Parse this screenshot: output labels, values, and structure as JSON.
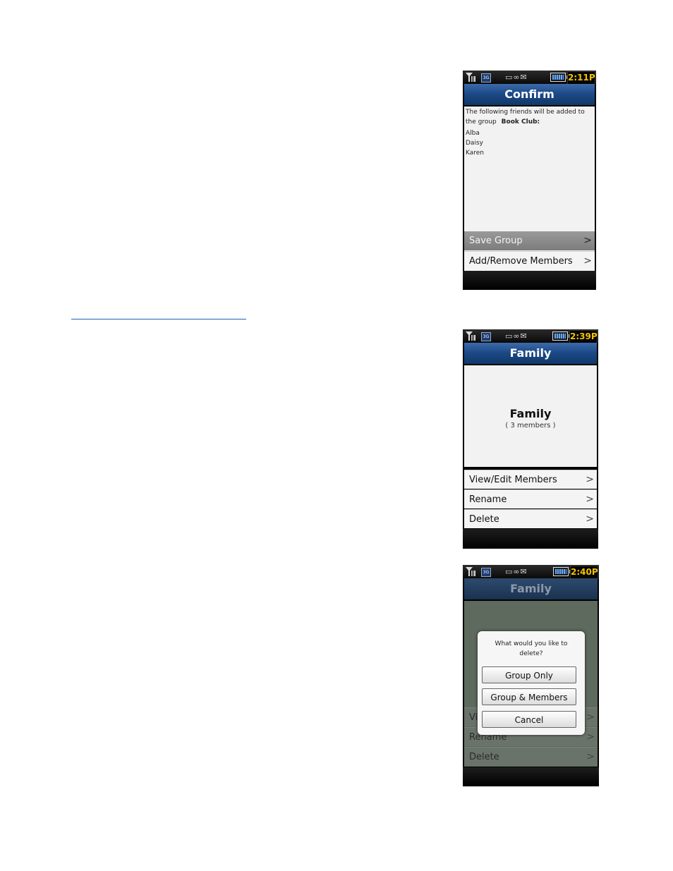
{
  "status": {
    "signal_icon": "signal-icon",
    "network_badge": "3G",
    "message_icons": "▭∞✉",
    "battery_icon": "battery-icon"
  },
  "screens": [
    {
      "time": "2:11P",
      "title": "Confirm",
      "intro_line1": "The following friends will be added to",
      "intro_line2": "the group",
      "group_name": "Book Club:",
      "members": [
        "Alba",
        "Daisy",
        "Karen"
      ],
      "menu": [
        {
          "label": "Save Group",
          "chevron": ">"
        },
        {
          "label": "Add/Remove Members",
          "chevron": ">"
        }
      ]
    },
    {
      "time": "2:39P",
      "title": "Family",
      "group_title": "Family",
      "member_count": "( 3 members )",
      "menu": [
        {
          "label": "View/Edit Members",
          "chevron": ">"
        },
        {
          "label": "Rename",
          "chevron": ">"
        },
        {
          "label": "Delete",
          "chevron": ">"
        }
      ]
    },
    {
      "time": "2:40P",
      "title": "Family",
      "background_menu": [
        {
          "label": "Vi",
          "chevron": ">"
        },
        {
          "label": "Rename",
          "chevron": ">"
        },
        {
          "label": "Delete",
          "chevron": ">"
        }
      ],
      "dialog": {
        "prompt_line1": "What would you like to",
        "prompt_line2": "delete?",
        "buttons": [
          "Group Only",
          "Group & Members",
          "Cancel"
        ]
      }
    }
  ]
}
